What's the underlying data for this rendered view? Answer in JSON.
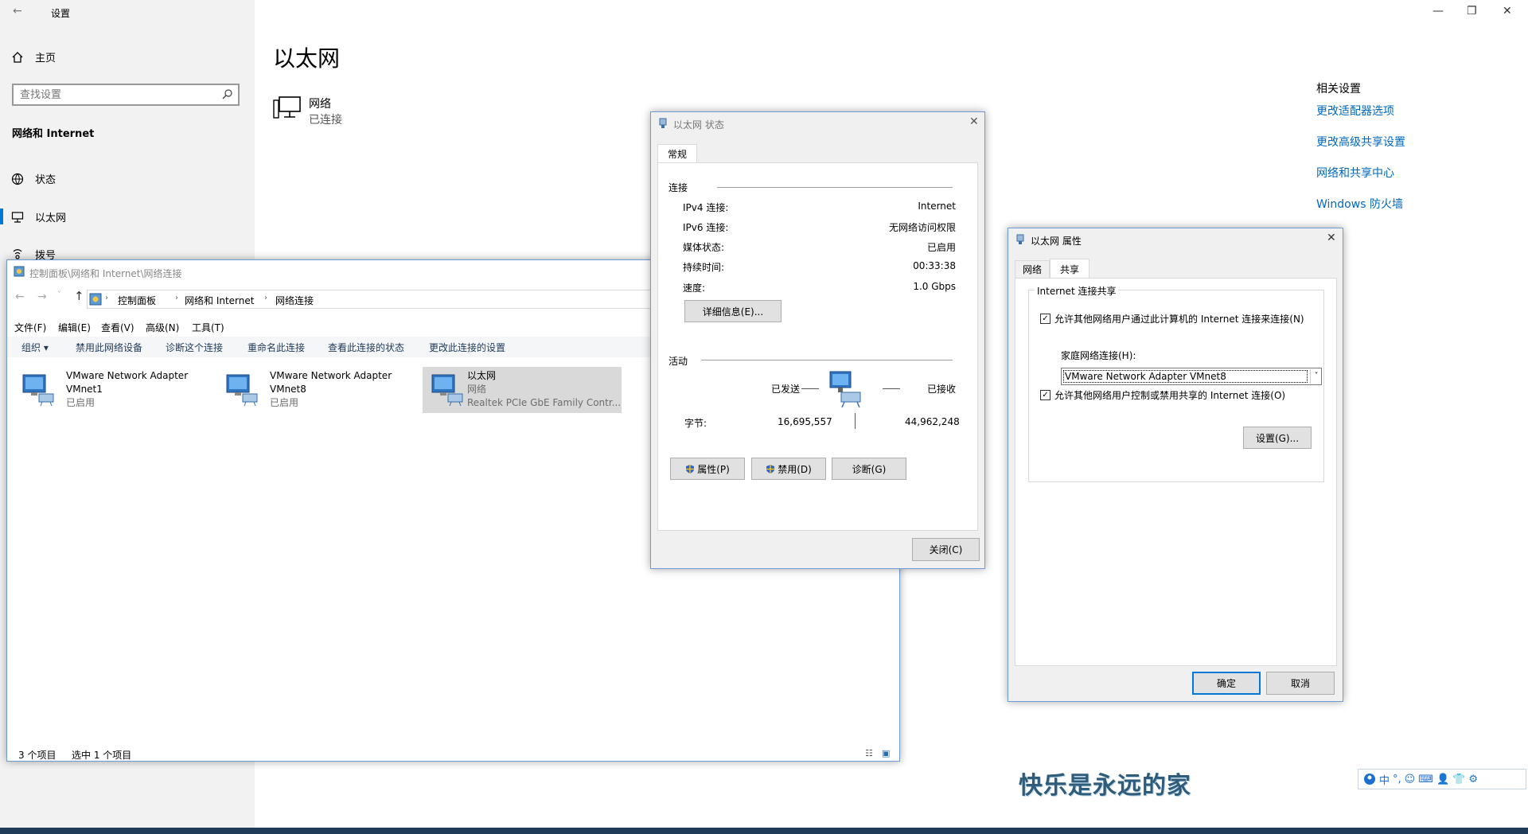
{
  "settings": {
    "title": "设置",
    "nav_home": "主页",
    "search_placeholder": "查找设置",
    "section": "网络和 Internet",
    "nav_items": [
      "状态",
      "以太网",
      "拨号"
    ],
    "page_title": "以太网",
    "network_name": "网络",
    "network_status": "已连接",
    "related_title": "相关设置",
    "related_links": [
      "更改适配器选项",
      "更改高级共享设置",
      "网络和共享中心",
      "Windows 防火墙"
    ]
  },
  "explorer": {
    "title": "控制面板\\网络和 Internet\\网络连接",
    "breadcrumb": [
      "控制面板",
      "网络和 Internet",
      "网络连接"
    ],
    "menu": [
      "文件(F)",
      "编辑(E)",
      "查看(V)",
      "高级(N)",
      "工具(T)"
    ],
    "commands": [
      "组织 ▾",
      "禁用此网络设备",
      "诊断这个连接",
      "重命名此连接",
      "查看此连接的状态",
      "更改此连接的设置"
    ],
    "adapters": [
      {
        "name": "VMware Network Adapter",
        "name2": "VMnet1",
        "status": "已启用"
      },
      {
        "name": "VMware Network Adapter",
        "name2": "VMnet8",
        "status": "已启用"
      },
      {
        "name": "以太网",
        "name2": "网络",
        "status": "Realtek PCIe GbE Family Contr..."
      }
    ],
    "status_count": "3 个项目",
    "status_selected": "选中 1 个项目"
  },
  "status_dialog": {
    "title": "以太网 状态",
    "tab": "常规",
    "connection_header": "连接",
    "rows": [
      {
        "k": "IPv4 连接:",
        "v": "Internet"
      },
      {
        "k": "IPv6 连接:",
        "v": "无网络访问权限"
      },
      {
        "k": "媒体状态:",
        "v": "已启用"
      },
      {
        "k": "持续时间:",
        "v": "00:33:38"
      },
      {
        "k": "速度:",
        "v": "1.0 Gbps"
      }
    ],
    "details_button": "详细信息(E)...",
    "activity_header": "活动",
    "sent_label": "已发送",
    "received_label": "已接收",
    "bytes_label": "字节:",
    "bytes_sent": "16,695,557",
    "bytes_received": "44,962,248",
    "properties_button": "属性(P)",
    "disable_button": "禁用(D)",
    "diagnose_button": "诊断(G)",
    "close_button": "关闭(C)"
  },
  "props_dialog": {
    "title": "以太网 属性",
    "tabs": [
      "网络",
      "共享"
    ],
    "group_title": "Internet 连接共享",
    "allow_share": "允许其他网络用户通过此计算机的 Internet 连接来连接(N)",
    "home_conn_label": "家庭网络连接(H):",
    "home_conn_value": "VMware Network Adapter VMnet8",
    "allow_control": "允许其他网络用户控制或禁用共享的 Internet 连接(O)",
    "settings_button": "设置(G)...",
    "ok_button": "确定",
    "cancel_button": "取消"
  },
  "desktop": {
    "slogan": "快乐是永远的家",
    "ime": [
      "中",
      "°,",
      "☺",
      "⌨",
      "👤",
      "👕",
      "⚙"
    ]
  },
  "colors": {
    "accent": "#0078d7",
    "link": "#0067c0",
    "dialog_bg": "#f0f0f0"
  }
}
